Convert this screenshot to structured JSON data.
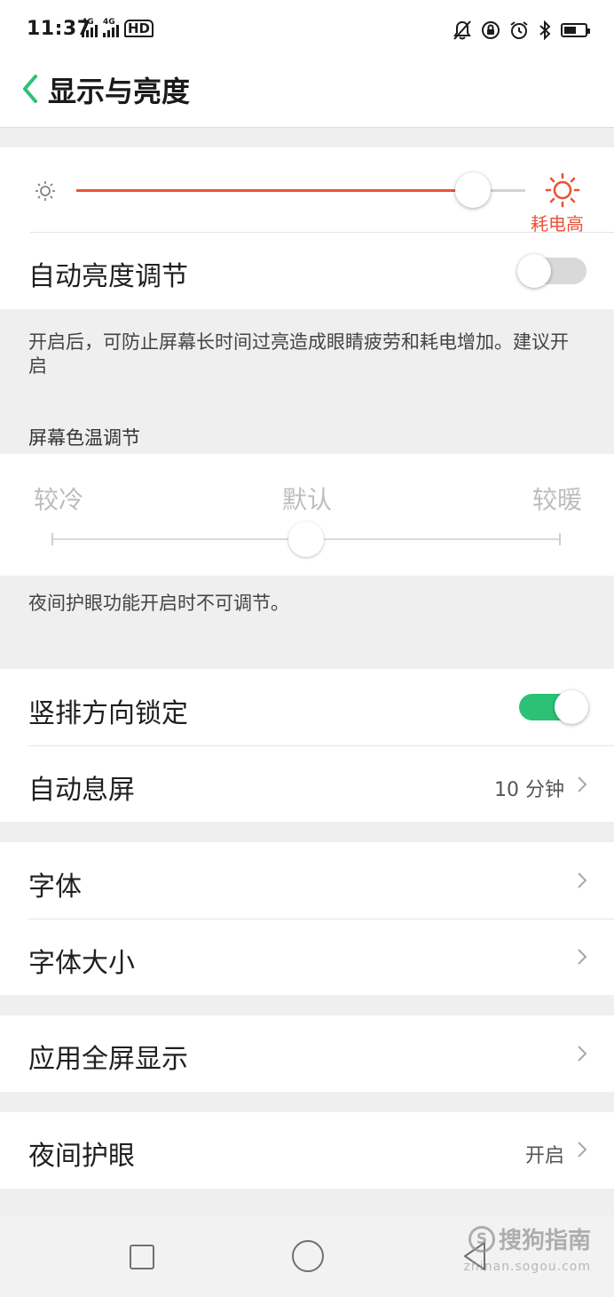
{
  "status_bar": {
    "time": "11:37",
    "network_1": "4G",
    "network_2": "4G",
    "hd_label": "HD",
    "battery_level": 0.6
  },
  "header": {
    "title": "显示与亮度"
  },
  "brightness": {
    "level": 0.88,
    "warning": "耗电高",
    "accent_color": "#e8533a"
  },
  "auto_brightness": {
    "label": "自动亮度调节",
    "enabled": false,
    "note": "开启后，可防止屏幕长时间过亮造成眼睛疲劳和耗电增加。建议开启"
  },
  "color_temperature": {
    "section_title": "屏幕色温调节",
    "labels": [
      "较冷",
      "默认",
      "较暖"
    ],
    "position": 0.5,
    "note": "夜间护眼功能开启时不可调节。"
  },
  "orientation_lock": {
    "label": "竖排方向锁定",
    "enabled": true,
    "toggle_color": "#2bc275"
  },
  "auto_sleep": {
    "label": "自动息屏",
    "value": "10 分钟"
  },
  "font": {
    "label": "字体"
  },
  "font_size": {
    "label": "字体大小"
  },
  "fullscreen_apps": {
    "label": "应用全屏显示"
  },
  "night_mode": {
    "label": "夜间护眼",
    "value": "开启"
  },
  "watermark": {
    "text": "搜狗指南",
    "sub": "zhinan.sogou.com",
    "logo_letter": "S"
  }
}
